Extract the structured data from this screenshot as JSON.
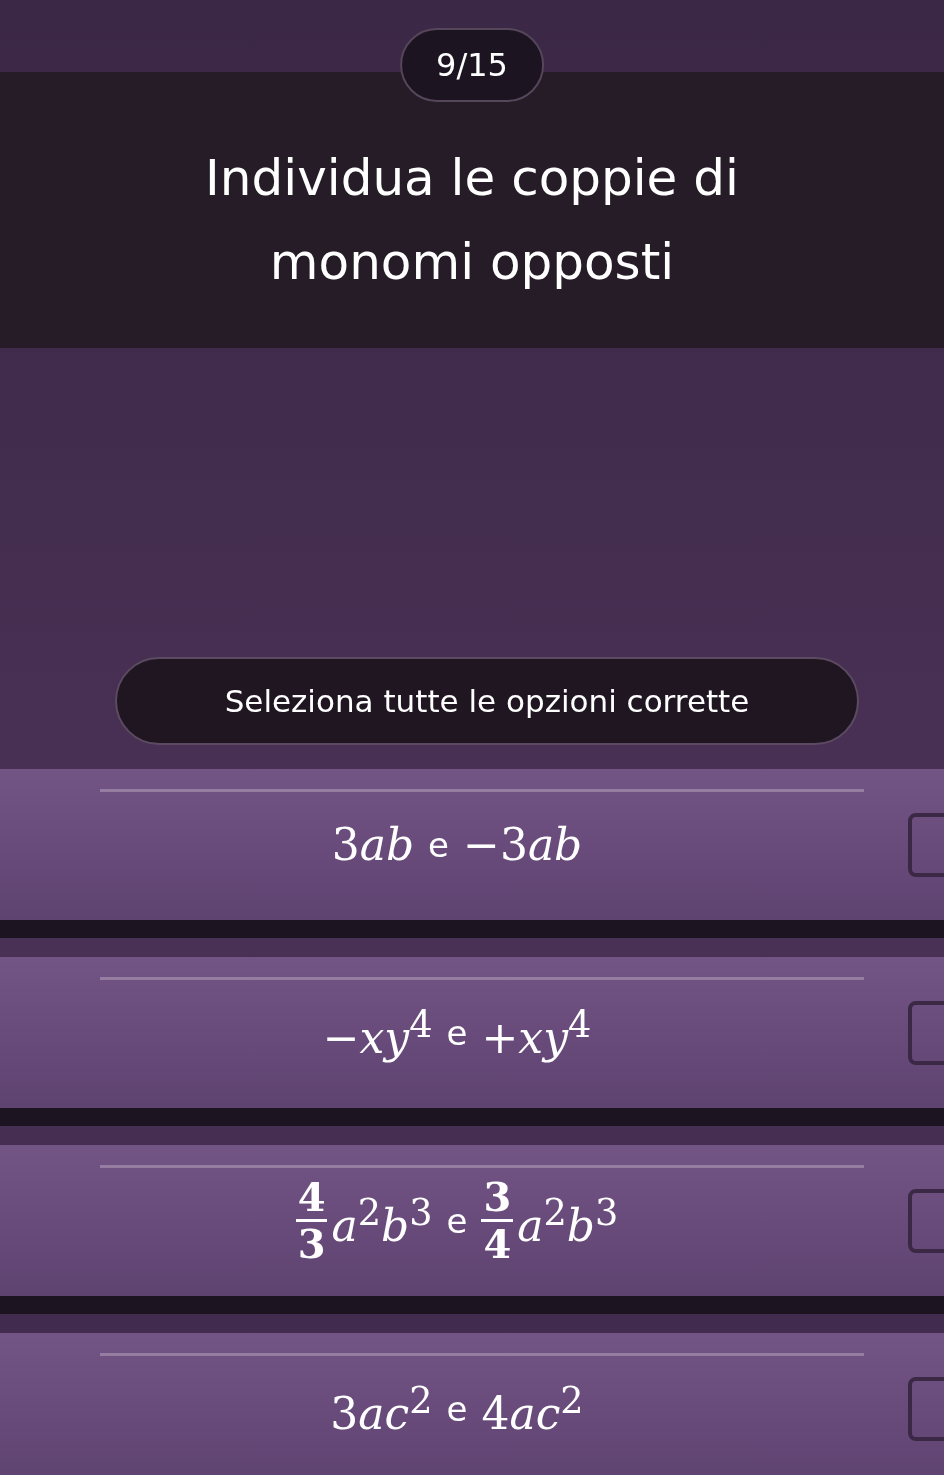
{
  "progress": "9/15",
  "question": "Individua le coppie di monomi opposti",
  "instruction": "Seleziona tutte le opzioni corrette",
  "options": [
    {
      "terms": [
        {
          "coefficient": "3",
          "body": "*ab*"
        },
        {
          "coefficient": "−3",
          "body": "*ab*"
        }
      ],
      "joiner": "e",
      "checked": false
    },
    {
      "terms": [
        {
          "body": "−*xy*$^{4}$"
        },
        {
          "body": "+*xy*$^{4}$"
        }
      ],
      "joiner": "e",
      "checked": false
    },
    {
      "terms": [
        {
          "numerator": "4",
          "denominator": "3",
          "body": "*a*$^{2}$*b*$^{3}$"
        },
        {
          "numerator": "3",
          "denominator": "4",
          "body": "*a*$^{2}$*b*$^{3}$"
        }
      ],
      "joiner": "e",
      "checked": false
    },
    {
      "terms": [
        {
          "coefficient": "3",
          "body": "*ac*$^{2}$"
        },
        {
          "coefficient": "4",
          "body": "*ac*$^{2}$"
        }
      ],
      "joiner": "e",
      "checked": false
    }
  ]
}
